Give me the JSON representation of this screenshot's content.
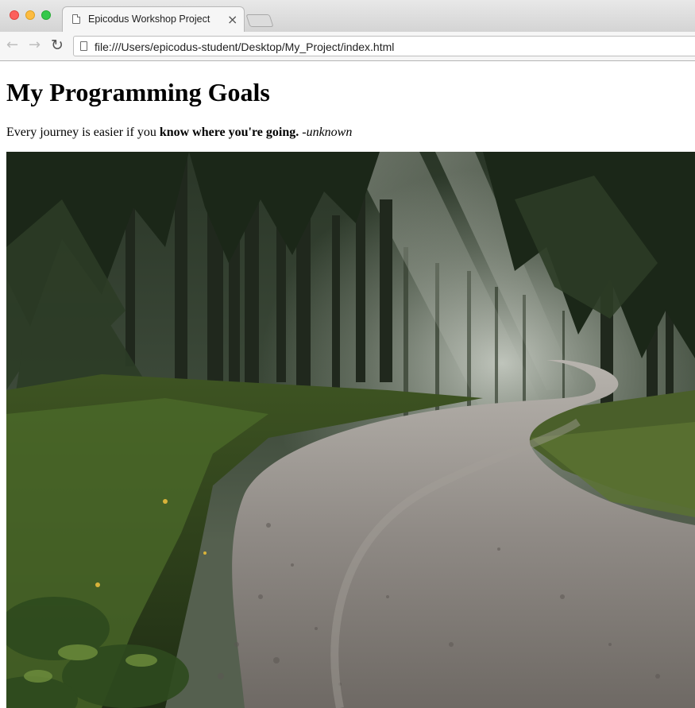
{
  "browser": {
    "tab_title": "Epicodus Workshop Project",
    "tab_close": "×",
    "url": "file:///Users/epicodus-student/Desktop/My_Project/index.html",
    "nav": {
      "back": "←",
      "forward": "→",
      "reload": "↻"
    }
  },
  "page": {
    "heading": "My Programming Goals",
    "quote": {
      "lead": "Every journey is easier if you ",
      "emphasis": "know where you're going.",
      "attribution": "-unknown"
    }
  },
  "image": {
    "subject": "winding gravel road through misty forest",
    "colors": {
      "forest_dark": "#1e2a1c",
      "moss": "#4c6b2a",
      "gravel": "#8a8580",
      "mist": "#c8ccc4"
    }
  }
}
